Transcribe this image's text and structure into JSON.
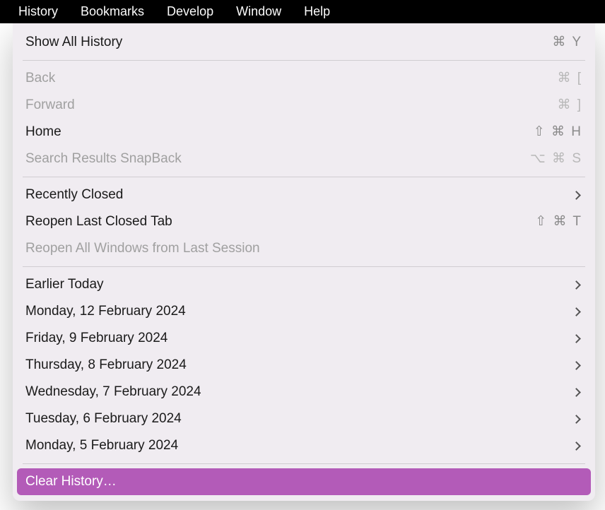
{
  "menubar": {
    "items": [
      {
        "label": "History",
        "active": true
      },
      {
        "label": "Bookmarks",
        "active": false
      },
      {
        "label": "Develop",
        "active": false
      },
      {
        "label": "Window",
        "active": false
      },
      {
        "label": "Help",
        "active": false
      }
    ]
  },
  "dropdown": {
    "section1": {
      "show_all_history": "Show All History",
      "show_all_history_shortcut": "⌘ Y"
    },
    "section2": {
      "back": "Back",
      "back_shortcut": "⌘ [",
      "forward": "Forward",
      "forward_shortcut": "⌘ ]",
      "home": "Home",
      "home_shortcut": "⇧ ⌘ H",
      "search_snapback": "Search Results SnapBack",
      "search_snapback_shortcut": "⌥ ⌘ S"
    },
    "section3": {
      "recently_closed": "Recently Closed",
      "reopen_last_tab": "Reopen Last Closed Tab",
      "reopen_last_tab_shortcut": "⇧ ⌘ T",
      "reopen_all_windows": "Reopen All Windows from Last Session"
    },
    "section4": {
      "items": [
        "Earlier Today",
        "Monday, 12 February 2024",
        "Friday, 9 February 2024",
        "Thursday, 8 February 2024",
        "Wednesday, 7 February 2024",
        "Tuesday, 6 February 2024",
        "Monday, 5 February 2024"
      ]
    },
    "section5": {
      "clear_history": "Clear History…"
    }
  }
}
